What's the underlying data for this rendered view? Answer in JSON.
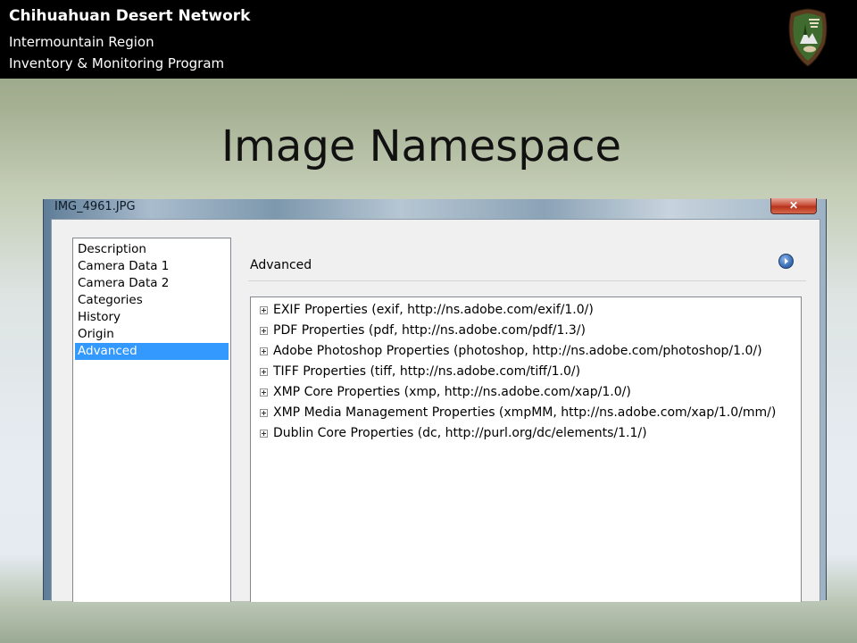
{
  "header": {
    "line1": "Chihuahuan Desert Network",
    "line2": "Intermountain Region",
    "line3": "Inventory & Monitoring Program",
    "logo_icon": "arrowhead-logo-icon"
  },
  "slide": {
    "title": "Image Namespace"
  },
  "window": {
    "title": "IMG_4961.JPG",
    "close_label": "✕",
    "sidebar": {
      "items": [
        {
          "label": "Description"
        },
        {
          "label": "Camera Data 1"
        },
        {
          "label": "Camera Data 2"
        },
        {
          "label": "Categories"
        },
        {
          "label": "History"
        },
        {
          "label": "Origin"
        },
        {
          "label": "Advanced",
          "selected": true
        }
      ]
    },
    "panel": {
      "title": "Advanced",
      "menu_icon": "circle-arrow-right-icon",
      "tree": [
        {
          "label": "EXIF Properties (exif, http://ns.adobe.com/exif/1.0/)"
        },
        {
          "label": "PDF Properties (pdf, http://ns.adobe.com/pdf/1.3/)"
        },
        {
          "label": "Adobe Photoshop Properties (photoshop, http://ns.adobe.com/photoshop/1.0/)"
        },
        {
          "label": "TIFF Properties (tiff, http://ns.adobe.com/tiff/1.0/)"
        },
        {
          "label": "XMP Core Properties (xmp, http://ns.adobe.com/xap/1.0/)"
        },
        {
          "label": "XMP Media Management Properties (xmpMM, http://ns.adobe.com/xap/1.0/mm/)"
        },
        {
          "label": "Dublin Core Properties (dc, http://purl.org/dc/elements/1.1/)"
        }
      ]
    }
  },
  "colors": {
    "selection": "#3399ff",
    "header_bg": "#000000"
  }
}
